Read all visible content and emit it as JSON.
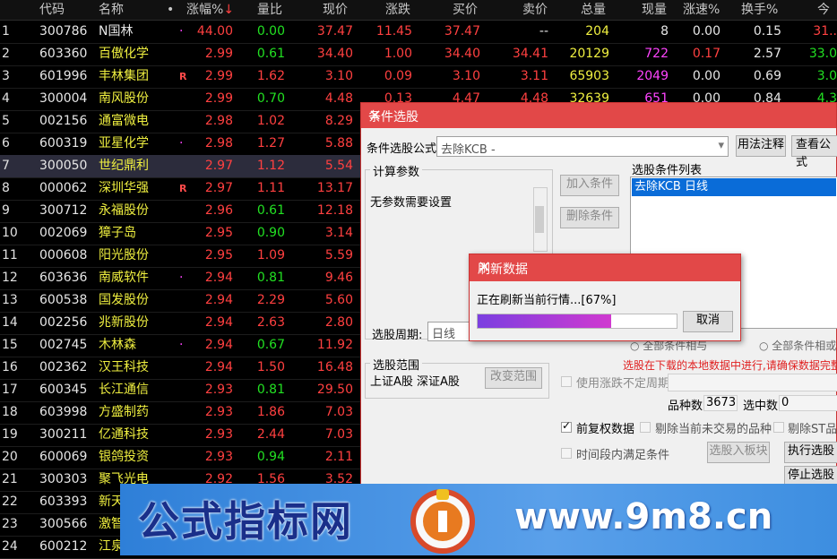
{
  "table": {
    "headers": [
      "代码",
      "名称",
      "•",
      "涨幅%",
      "量比",
      "现价",
      "涨跌",
      "买价",
      "卖价",
      "总量",
      "现量",
      "涨速%",
      "换手%",
      "今"
    ],
    "sort_arrow": "↓",
    "selected_index": 6,
    "rows": [
      {
        "idx": "1",
        "code": "300786",
        "name": "N国林",
        "mark": "·",
        "chg": "44.00",
        "vr": "0.00",
        "price": "37.47",
        "diff": "11.45",
        "bid": "37.47",
        "ask": "--",
        "vol": "204",
        "cur": "8",
        "spd": "0.00",
        "turn": "0.15",
        "today": "31.."
      },
      {
        "idx": "2",
        "code": "603360",
        "name": "百傲化学",
        "mark": "",
        "chg": "2.99",
        "vr": "0.61",
        "price": "34.40",
        "diff": "1.00",
        "bid": "34.40",
        "ask": "34.41",
        "vol": "20129",
        "cur": "722",
        "spd": "0.17",
        "turn": "2.57",
        "today": "33.0"
      },
      {
        "idx": "3",
        "code": "601996",
        "name": "丰林集团",
        "mark": "R",
        "chg": "2.99",
        "vr": "1.62",
        "price": "3.10",
        "diff": "0.09",
        "bid": "3.10",
        "ask": "3.11",
        "vol": "65903",
        "cur": "2049",
        "spd": "0.00",
        "turn": "0.69",
        "today": "3.0"
      },
      {
        "idx": "4",
        "code": "300004",
        "name": "南风股份",
        "mark": "",
        "chg": "2.99",
        "vr": "0.70",
        "price": "4.48",
        "diff": "0.13",
        "bid": "4.47",
        "ask": "4.48",
        "vol": "32639",
        "cur": "651",
        "spd": "0.00",
        "turn": "0.84",
        "today": "4.3"
      },
      {
        "idx": "5",
        "code": "002156",
        "name": "通富微电",
        "mark": "",
        "chg": "2.98",
        "vr": "1.02",
        "price": "8.29",
        "diff": "",
        "bid": "",
        "ask": "",
        "vol": "",
        "cur": "",
        "spd": "",
        "turn": "",
        "today": ""
      },
      {
        "idx": "6",
        "code": "600319",
        "name": "亚星化学",
        "mark": "·",
        "chg": "2.98",
        "vr": "1.27",
        "price": "5.88",
        "diff": "",
        "bid": "",
        "ask": "",
        "vol": "",
        "cur": "",
        "spd": "",
        "turn": "",
        "today": ""
      },
      {
        "idx": "7",
        "code": "300050",
        "name": "世纪鼎利",
        "mark": "",
        "chg": "2.97",
        "vr": "1.12",
        "price": "5.54",
        "diff": "",
        "bid": "",
        "ask": "",
        "vol": "",
        "cur": "",
        "spd": "",
        "turn": "",
        "today": ""
      },
      {
        "idx": "8",
        "code": "000062",
        "name": "深圳华强",
        "mark": "R",
        "chg": "2.97",
        "vr": "1.11",
        "price": "13.17",
        "diff": "",
        "bid": "",
        "ask": "",
        "vol": "",
        "cur": "",
        "spd": "",
        "turn": "",
        "today": ""
      },
      {
        "idx": "9",
        "code": "300712",
        "name": "永福股份",
        "mark": "",
        "chg": "2.96",
        "vr": "0.61",
        "price": "12.18",
        "diff": "",
        "bid": "",
        "ask": "",
        "vol": "",
        "cur": "",
        "spd": "",
        "turn": "",
        "today": ""
      },
      {
        "idx": "10",
        "code": "002069",
        "name": "獐子岛",
        "mark": "",
        "chg": "2.95",
        "vr": "0.90",
        "price": "3.14",
        "diff": "",
        "bid": "",
        "ask": "",
        "vol": "",
        "cur": "",
        "spd": "",
        "turn": "",
        "today": ""
      },
      {
        "idx": "11",
        "code": "000608",
        "name": "阳光股份",
        "mark": "",
        "chg": "2.95",
        "vr": "1.09",
        "price": "5.59",
        "diff": "",
        "bid": "",
        "ask": "",
        "vol": "",
        "cur": "",
        "spd": "",
        "turn": "",
        "today": ""
      },
      {
        "idx": "12",
        "code": "603636",
        "name": "南威软件",
        "mark": "·",
        "chg": "2.94",
        "vr": "0.81",
        "price": "9.46",
        "diff": "",
        "bid": "",
        "ask": "",
        "vol": "",
        "cur": "",
        "spd": "",
        "turn": "",
        "today": ""
      },
      {
        "idx": "13",
        "code": "600538",
        "name": "国发股份",
        "mark": "",
        "chg": "2.94",
        "vr": "2.29",
        "price": "5.60",
        "diff": "",
        "bid": "",
        "ask": "",
        "vol": "",
        "cur": "",
        "spd": "",
        "turn": "",
        "today": ""
      },
      {
        "idx": "14",
        "code": "002256",
        "name": "兆新股份",
        "mark": "",
        "chg": "2.94",
        "vr": "2.63",
        "price": "2.80",
        "diff": "",
        "bid": "",
        "ask": "",
        "vol": "",
        "cur": "",
        "spd": "",
        "turn": "",
        "today": ""
      },
      {
        "idx": "15",
        "code": "002745",
        "name": "木林森",
        "mark": "·",
        "chg": "2.94",
        "vr": "0.67",
        "price": "11.92",
        "diff": "",
        "bid": "",
        "ask": "",
        "vol": "",
        "cur": "",
        "spd": "",
        "turn": "",
        "today": ""
      },
      {
        "idx": "16",
        "code": "002362",
        "name": "汉王科技",
        "mark": "",
        "chg": "2.94",
        "vr": "1.50",
        "price": "16.48",
        "diff": "",
        "bid": "",
        "ask": "",
        "vol": "",
        "cur": "",
        "spd": "",
        "turn": "",
        "today": ""
      },
      {
        "idx": "17",
        "code": "600345",
        "name": "长江通信",
        "mark": "",
        "chg": "2.93",
        "vr": "0.81",
        "price": "29.50",
        "diff": "",
        "bid": "",
        "ask": "",
        "vol": "",
        "cur": "",
        "spd": "",
        "turn": "",
        "today": ""
      },
      {
        "idx": "18",
        "code": "603998",
        "name": "方盛制药",
        "mark": "",
        "chg": "2.93",
        "vr": "1.86",
        "price": "7.03",
        "diff": "",
        "bid": "",
        "ask": "",
        "vol": "",
        "cur": "",
        "spd": "",
        "turn": "",
        "today": ""
      },
      {
        "idx": "19",
        "code": "300211",
        "name": "亿通科技",
        "mark": "",
        "chg": "2.93",
        "vr": "2.44",
        "price": "7.03",
        "diff": "",
        "bid": "",
        "ask": "",
        "vol": "",
        "cur": "",
        "spd": "",
        "turn": "",
        "today": ""
      },
      {
        "idx": "20",
        "code": "600069",
        "name": "银鸽投资",
        "mark": "",
        "chg": "2.93",
        "vr": "0.94",
        "price": "2.11",
        "diff": "",
        "bid": "",
        "ask": "",
        "vol": "",
        "cur": "",
        "spd": "",
        "turn": "",
        "today": ""
      },
      {
        "idx": "21",
        "code": "300303",
        "name": "聚飞光电",
        "mark": "",
        "chg": "2.92",
        "vr": "1.56",
        "price": "3.52",
        "diff": "",
        "bid": "",
        "ask": "",
        "vol": "",
        "cur": "",
        "spd": "",
        "turn": "",
        "today": ""
      },
      {
        "idx": "22",
        "code": "603393",
        "name": "新天",
        "mark": "",
        "chg": "",
        "vr": "",
        "price": "",
        "diff": "",
        "bid": "",
        "ask": "",
        "vol": "",
        "cur": "",
        "spd": "",
        "turn": "",
        "today": ""
      },
      {
        "idx": "23",
        "code": "300566",
        "name": "激智",
        "mark": "",
        "chg": "",
        "vr": "",
        "price": "",
        "diff": "",
        "bid": "",
        "ask": "",
        "vol": "",
        "cur": "",
        "spd": "",
        "turn": "",
        "today": ""
      },
      {
        "idx": "24",
        "code": "600212",
        "name": "江泉",
        "mark": "",
        "chg": "",
        "vr": "",
        "price": "",
        "diff": "",
        "bid": "",
        "ask": "",
        "vol": "",
        "cur": "",
        "spd": "",
        "turn": "",
        "today": ""
      }
    ]
  },
  "cond_dialog": {
    "title": "条件选股",
    "close": "×",
    "formula_label": "条件选股公式",
    "formula_value": "去除KCB    -",
    "usage_btn": "用法注释",
    "view_btn": "查看公式",
    "params_group": "计算参数",
    "params_text": "无参数需要设置",
    "add_btn": "加入条件",
    "del_btn": "删除条件",
    "list_label": "选股条件列表",
    "list_item": "去除KCB  日线",
    "period_label": "选股周期:",
    "period_value": "日线",
    "radio_partial": "全部条件相与",
    "radio_all": "全部条件相或",
    "warning": "选股在下载的本地数据中进行,请确保数据完整",
    "scope_group": "选股范围",
    "scope_value": "上证A股 深证A股",
    "change_scope_btn": "改变范围",
    "use_period_label": "使用涨跌不定周期",
    "count_label": "品种数",
    "count_value": "3673",
    "selected_label": "选中数",
    "selected_value": "0",
    "adj_label": "前复权数据",
    "remove_untraded": "剔除当前未交易的品种",
    "remove_st": "剔除ST品种",
    "time_cond": "时间段内满足条件",
    "to_block_btn": "选股入板块",
    "run_btn": "执行选股",
    "stop_btn": "停止选股"
  },
  "refresh_dialog": {
    "title": "刷新数据",
    "close": "×",
    "message": "正在刷新当前行情...[67%]",
    "progress": 0.67,
    "cancel_btn": "取消"
  },
  "watermark": {
    "cn_text": "公式指标网",
    "url_text": "www.9m8.cn"
  },
  "colors": {
    "up": "#ff4040",
    "down": "#22e022",
    "title_bar": "#e24848"
  }
}
